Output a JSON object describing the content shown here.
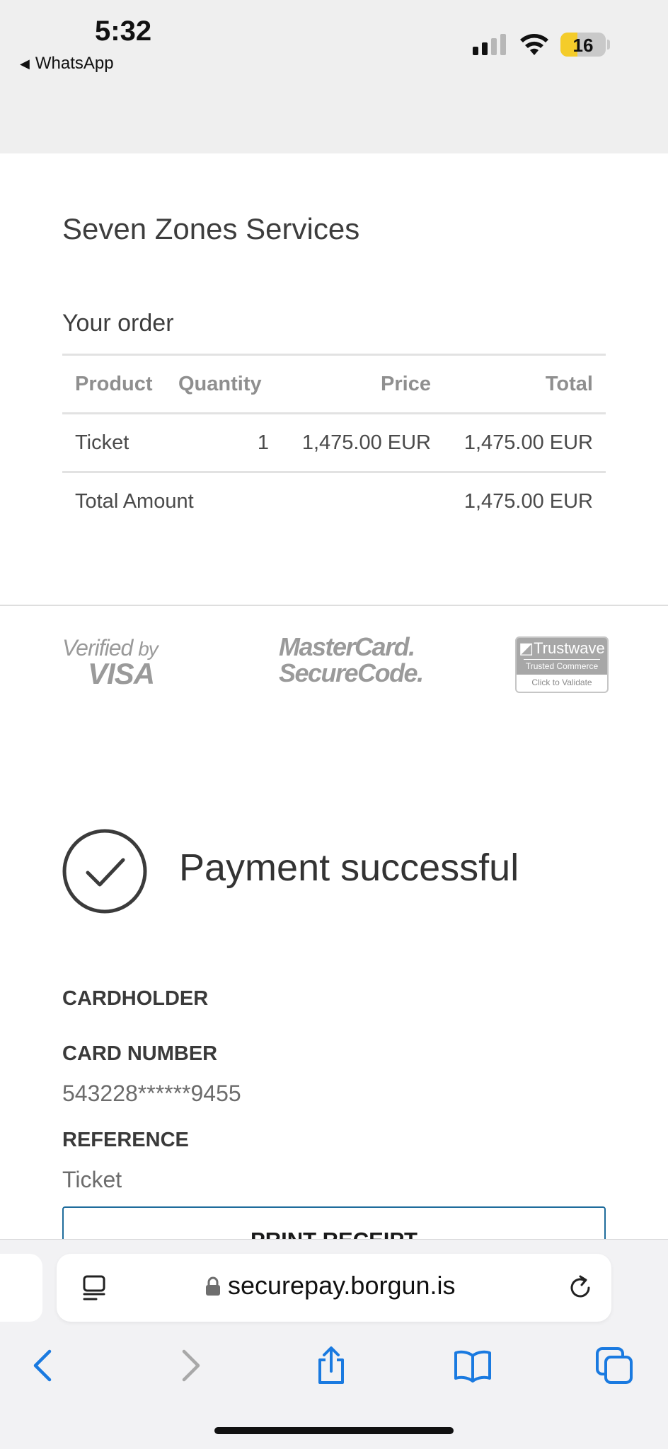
{
  "status_bar": {
    "time": "5:32",
    "back_app": "WhatsApp",
    "back_arrow_icon": "left-triangle-icon",
    "battery_level": "16",
    "battery_color": "#f4cc2a",
    "signal_bars_active": 2,
    "signal_bars_total": 4
  },
  "merchant": {
    "name": "Seven Zones Services"
  },
  "order": {
    "title": "Your order",
    "columns": [
      "Product",
      "Quantity",
      "Price",
      "Total"
    ],
    "rows": [
      {
        "product": "Ticket",
        "quantity": "1",
        "price": "1,475.00 EUR",
        "total": "1,475.00 EUR"
      }
    ],
    "total_label": "Total Amount",
    "total_value": "1,475.00 EUR"
  },
  "security_logos": {
    "visa_line1": "Verified",
    "visa_by": "by",
    "visa_line2": "VISA",
    "mastercard_line1": "MasterCard.",
    "mastercard_line2": "SecureCode.",
    "trustwave_name": "Trustwave",
    "trustwave_tagline": "Trusted Commerce",
    "trustwave_action": "Click to Validate"
  },
  "payment": {
    "status": "Payment successful",
    "status_icon": "checkmark-circle-icon",
    "cardholder_label": "CARDHOLDER",
    "card_number_label": "CARD NUMBER",
    "card_number_value": "543228******9455",
    "reference_label": "REFERENCE",
    "reference_value": "Ticket",
    "print_button": "PRINT RECEIPT"
  },
  "browser": {
    "url": "securepay.borgun.is",
    "reader_icon": "reader-mode-icon",
    "lock_icon": "lock-icon",
    "reload_icon": "reload-icon",
    "toolbar_icons": [
      "back-icon",
      "forward-icon",
      "share-icon",
      "bookmarks-icon",
      "tabs-icon"
    ],
    "accent_color": "#1a7ae0",
    "forward_disabled_color": "#a8a8a8"
  }
}
